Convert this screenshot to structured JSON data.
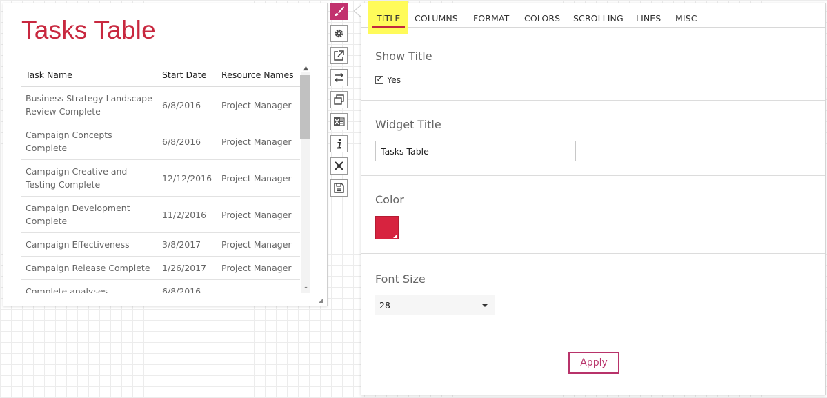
{
  "widget": {
    "title": "Tasks Table",
    "title_color": "#c8283f",
    "columns": [
      "Task Name",
      "Start Date",
      "Resource Names"
    ],
    "rows": [
      {
        "name": "Business Strategy Landscape Review Complete",
        "start": "6/8/2016",
        "resource": "Project Manager"
      },
      {
        "name": "Campaign Concepts Complete",
        "start": "6/8/2016",
        "resource": "Project Manager"
      },
      {
        "name": "Campaign Creative and Testing Complete",
        "start": "12/12/2016",
        "resource": "Project Manager"
      },
      {
        "name": "Campaign Development Complete",
        "start": "11/2/2016",
        "resource": "Project Manager"
      },
      {
        "name": "Campaign Effectiveness",
        "start": "3/8/2017",
        "resource": "Project Manager"
      },
      {
        "name": "Campaign Release Complete",
        "start": "1/26/2017",
        "resource": "Project Manager"
      },
      {
        "name": "Complete analyses",
        "start": "6/8/2016",
        "resource": ""
      }
    ]
  },
  "toolbar": {
    "buttons": [
      "paintbrush-icon",
      "gear-icon",
      "external-link-icon",
      "swap-arrows-icon",
      "duplicate-icon",
      "excel-icon",
      "info-icon",
      "close-icon",
      "save-icon"
    ],
    "active_color": "#c2326e"
  },
  "panel": {
    "tabs": [
      "TITLE",
      "COLUMNS",
      "FORMAT",
      "COLORS",
      "SCROLLING",
      "LINES",
      "MISC"
    ],
    "active_tab": "TITLE",
    "show_title": {
      "label": "Show Title",
      "checkbox_label": "Yes",
      "checked": true
    },
    "widget_title": {
      "label": "Widget Title",
      "value": "Tasks Table"
    },
    "color": {
      "label": "Color",
      "value": "#d7233f"
    },
    "font_size": {
      "label": "Font Size",
      "value": "28"
    },
    "apply_label": "Apply"
  }
}
